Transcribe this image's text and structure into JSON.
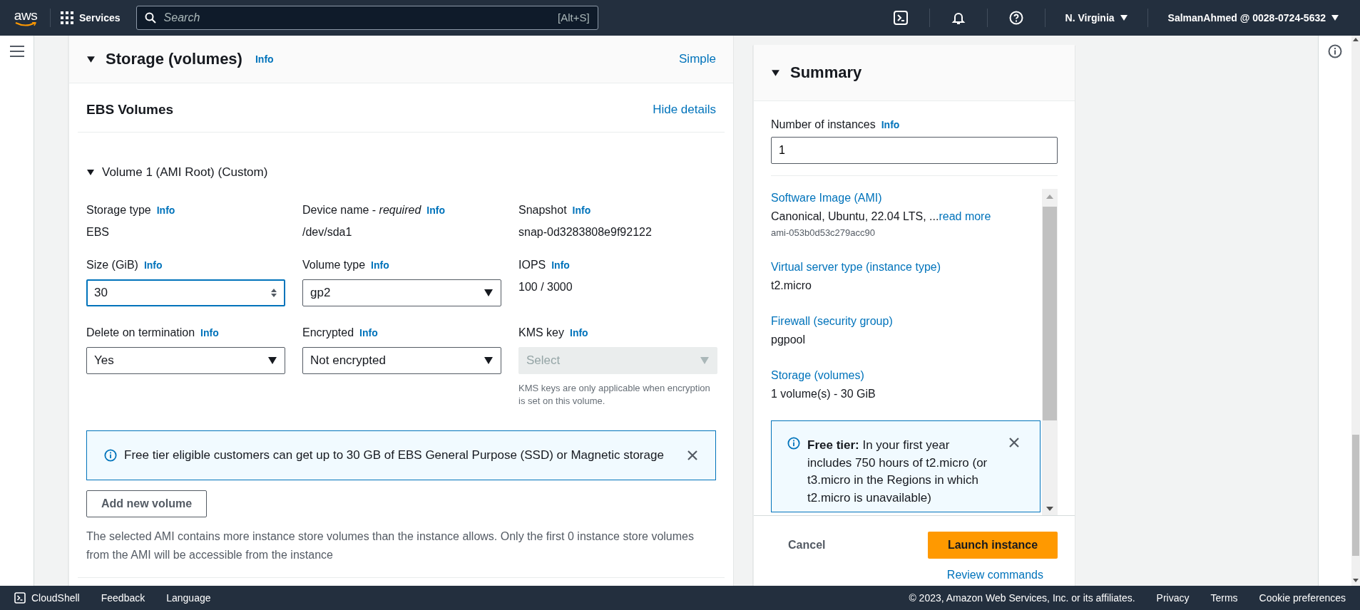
{
  "top_nav": {
    "logo": "aws",
    "services": "Services",
    "search": {
      "placeholder": "Search",
      "shortcut": "[Alt+S]"
    },
    "region": "N. Virginia",
    "account": "SalmanAhmed @ 0028-0724-5632"
  },
  "storage": {
    "title": "Storage (volumes)",
    "info": "Info",
    "expanded": true,
    "mode_link": "Simple",
    "ebs_title": "EBS Volumes",
    "details_link": "Hide details",
    "volume": {
      "title": "Volume 1 (AMI Root) (Custom)",
      "expanded": true,
      "fields": [
        {
          "kind": "text",
          "label": "Storage type",
          "info": "Info",
          "value": "EBS"
        },
        {
          "kind": "text",
          "label": "Device name - *required*",
          "info": "Info",
          "value": "/dev/sda1"
        },
        {
          "kind": "text",
          "label": "Snapshot",
          "info": "Info",
          "value": "snap-0d3283808e9f92122"
        },
        {
          "kind": "number",
          "label": "Size (GiB)",
          "info": "Info",
          "value": "30",
          "focused": true,
          "disabled": false
        },
        {
          "kind": "select",
          "label": "Volume type",
          "info": "Info",
          "value": "gp2",
          "focused": false,
          "disabled": false
        },
        {
          "kind": "text",
          "label": "IOPS",
          "info": "Info",
          "value": "100 / 3000"
        },
        {
          "kind": "select",
          "label": "Delete on termination",
          "info": "Info",
          "value": "Yes",
          "focused": false,
          "disabled": false
        },
        {
          "kind": "select",
          "label": "Encrypted",
          "info": "Info",
          "value": "Not encrypted",
          "focused": false,
          "disabled": false
        },
        {
          "kind": "select",
          "label": "KMS key",
          "info": "Info",
          "placeholder": "Select",
          "focused": false,
          "disabled": true,
          "hint": "KMS keys are only applicable when encryption is set on this volume."
        }
      ]
    },
    "alert": {
      "text": "Free tier eligible customers can get up to 30 GB of EBS General Purpose (SSD) or Magnetic storage"
    },
    "add_button": "Add new volume",
    "note": "The selected AMI contains more instance store volumes than the instance allows. Only the first 0 instance store volumes from the AMI will be accessible from the instance"
  },
  "summary": {
    "title": "Summary",
    "expanded": true,
    "instances_label": "Number of instances",
    "instances_info": "Info",
    "instances_value": "1",
    "items": [
      {
        "label": "Software Image (AMI)",
        "value": "Canonical, Ubuntu, 22.04 LTS, ...",
        "link": "read more",
        "sub": "ami-053b0d53c279acc90"
      },
      {
        "label": "Virtual server type (instance type)",
        "value": "t2.micro"
      },
      {
        "label": "Firewall (security group)",
        "value": "pgpool"
      },
      {
        "label": "Storage (volumes)",
        "value": "1 volume(s) - 30 GiB"
      }
    ],
    "alert": {
      "text": "**Free tier:** In your first year includes 750 hours of t2.micro (or t3.micro in the Regions in which t2.micro is unavailable)"
    },
    "cancel": "Cancel",
    "launch": "Launch instance",
    "review": "Review commands"
  },
  "footer": {
    "left": [
      "CloudShell",
      "Feedback",
      "Language"
    ],
    "copyright": "© 2023, Amazon Web Services, Inc. or its affiliates.",
    "links": [
      "Privacy",
      "Terms",
      "Cookie preferences"
    ]
  }
}
